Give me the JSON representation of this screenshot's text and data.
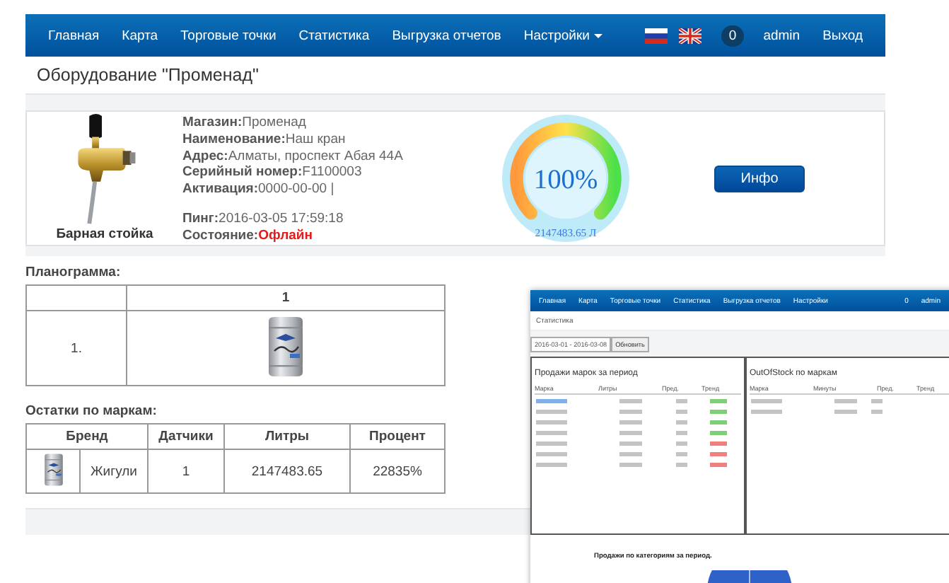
{
  "nav": {
    "items": [
      {
        "label": "Главная",
        "dropdown": false
      },
      {
        "label": "Карта",
        "dropdown": false
      },
      {
        "label": "Торговые точки",
        "dropdown": false
      },
      {
        "label": "Статистика",
        "dropdown": false
      },
      {
        "label": "Выгрузка отчетов",
        "dropdown": false
      },
      {
        "label": "Настройки",
        "dropdown": true
      }
    ],
    "badge": "0",
    "user": "admin",
    "logout": "Выход"
  },
  "page_title": "Оборудование \"Променад\"",
  "equipment": {
    "image_caption": "Барная стойка",
    "field_groups": [
      [
        {
          "label": "Магазин:",
          "value": "Променад",
          "kind": "text"
        },
        {
          "label": "Наименование:",
          "value": "Наш кран",
          "kind": "text"
        },
        {
          "label": "Адрес:",
          "value": "Алматы, проспект Абая 44А",
          "kind": "text"
        },
        {
          "label": "Серийный номер:",
          "value": "F1100003",
          "kind": "text"
        },
        {
          "label": "Активация:",
          "value": "0000-00-00 |",
          "kind": "text"
        }
      ],
      [
        {
          "label": "Пинг:",
          "value": "2016-03-05 17:59:18",
          "kind": "text"
        },
        {
          "label": "Состояние:",
          "value": "Офлайн",
          "kind": "alert"
        }
      ]
    ],
    "gauge": {
      "level": 1,
      "percent_text": "100%",
      "volume_text": "2147483.65 Л"
    },
    "info_button": "Инфо"
  },
  "planogram": {
    "title": "Планограмма:",
    "columns": [
      "1"
    ],
    "rows": [
      {
        "label": "1."
      }
    ]
  },
  "stock": {
    "title": "Остатки по маркам:",
    "columns": [
      "Бренд",
      "Датчики",
      "Литры",
      "Процент"
    ],
    "rows": [
      {
        "brand": "Жигули",
        "sensors": "1",
        "liters": "2147483.65",
        "percent": "22835%"
      }
    ]
  },
  "inset": {
    "nav_items": [
      "Главная",
      "Карта",
      "Торговые точки",
      "Статистика",
      "Выгрузка отчетов",
      "Настройки"
    ],
    "badge": "0",
    "user": "admin",
    "title": "Статистика",
    "date_value": "2016-03-01 - 2016-03-08",
    "refresh_button": "Обновить",
    "panels": [
      {
        "title": "Продажи марок за период",
        "columns": [
          "Марка",
          "Литры",
          "Пред.",
          "Тренд"
        ]
      },
      {
        "title": "OutOfStock по маркам",
        "columns": [
          "Марка",
          "Минуты",
          "Пред.",
          "Тренд"
        ]
      }
    ],
    "bottom_title": "Продажи по категориям за период."
  }
}
